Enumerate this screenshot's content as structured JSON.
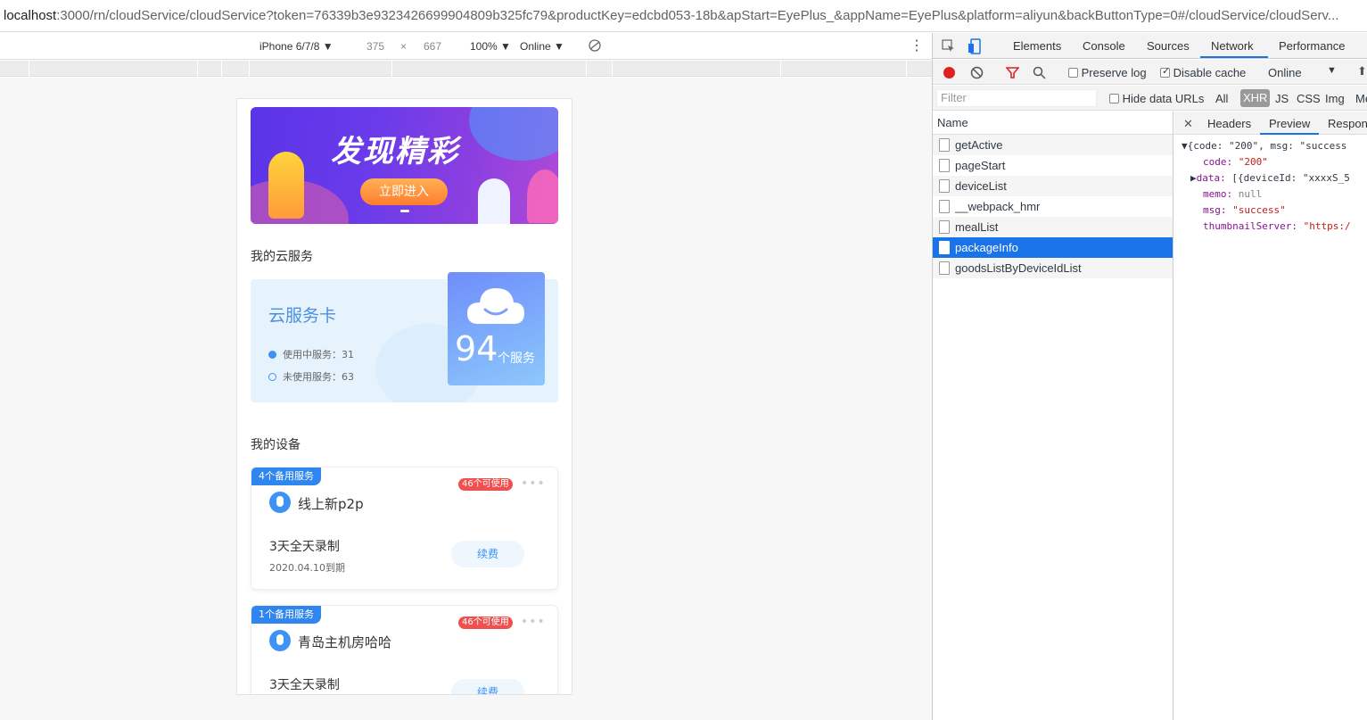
{
  "url": {
    "host": "localhost",
    "rest": ":3000/rn/cloudService/cloudService?token=76339b3e9323426699904809b325fc79&productKey=edcbd053-18b&apStart=EyePlus_&appName=EyePlus&platform=aliyun&backButtonType=0#/cloudService/cloudServ..."
  },
  "device_toolbar": {
    "device": "iPhone 6/7/8 ▼",
    "width": "375",
    "times": "×",
    "height": "667",
    "zoom": "100% ▼",
    "network": "Online ▼"
  },
  "app": {
    "banner": {
      "headline": "发现精彩",
      "cta": "立即进入"
    },
    "cloud_section_title": "我的云服务",
    "cloud_card": {
      "title": "云服务卡",
      "in_use": "使用中服务：31",
      "unused": "未使用服务：63",
      "count": "94",
      "count_unit": "个服务"
    },
    "devices_section_title": "我的设备",
    "devices": [
      {
        "spare": "4个备用服务",
        "available": "46个可使用",
        "more": "•••",
        "name": "线上新p2p",
        "plan": "3天全天录制",
        "expire": "2020.04.10到期",
        "renew": "续费"
      },
      {
        "spare": "1个备用服务",
        "available": "46个可使用",
        "more": "•••",
        "name": "青岛主机房哈哈",
        "plan": "3天全天录制",
        "expire": "",
        "renew": "续费"
      }
    ],
    "colors": {
      "primary": "#3d93f5",
      "badge_red": "#f05050",
      "card_bg": "#e6f3fd"
    }
  },
  "devtools": {
    "tabs": [
      "Elements",
      "Console",
      "Sources",
      "Network",
      "Performance"
    ],
    "active_tab": "Network",
    "toolbar": {
      "preserve_log": "Preserve log",
      "disable_cache": "Disable cache",
      "throttle": "Online"
    },
    "filter": {
      "placeholder": "Filter",
      "hide_data_urls": "Hide data URLs",
      "types": [
        "All",
        "XHR",
        "JS",
        "CSS",
        "Img",
        "Me"
      ]
    },
    "list_header": "Name",
    "requests": [
      "getActive",
      "pageStart",
      "deviceList",
      "__webpack_hmr",
      "mealList",
      "packageInfo",
      "goodsListByDeviceIdList"
    ],
    "selected_request": "packageInfo",
    "preview_tabs": [
      "Headers",
      "Preview",
      "Respon"
    ],
    "preview": {
      "line0": "{code: \"200\", msg: \"success",
      "code_key": "code:",
      "code_val": "\"200\"",
      "data_key": "data:",
      "data_val": "[{deviceId: \"xxxxS_5",
      "memo_key": "memo:",
      "memo_val": "null",
      "msg_key": "msg:",
      "msg_val": "\"success\"",
      "thumb_key": "thumbnailServer:",
      "thumb_val": "\"https:/"
    }
  }
}
